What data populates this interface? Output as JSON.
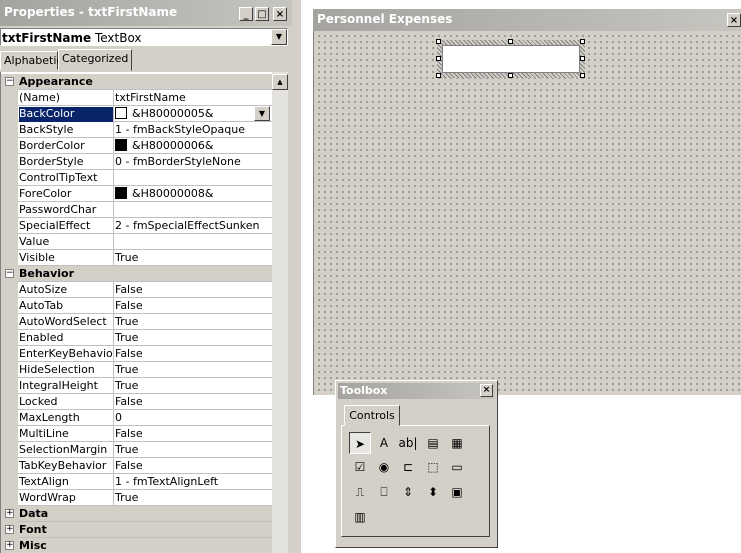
{
  "properties": {
    "title": "Properties - txtFirstName",
    "object_name": "txtFirstName",
    "object_type": "TextBox",
    "tabs": [
      "Alphabetic",
      "Categorized"
    ],
    "active_tab": "Categorized",
    "rows": [
      {
        "kind": "cat",
        "name": "Appearance",
        "expander": "⊟"
      },
      {
        "name": "(Name)",
        "value": "txtFirstName"
      },
      {
        "name": "BackColor",
        "value": "&H80000005&",
        "swatch": "#ffffff",
        "selected": true,
        "dropdown": true
      },
      {
        "name": "BackStyle",
        "value": "1 - fmBackStyleOpaque"
      },
      {
        "name": "BorderColor",
        "value": "&H80000006&",
        "swatch": "#000000"
      },
      {
        "name": "BorderStyle",
        "value": "0 - fmBorderStyleNone"
      },
      {
        "name": "ControlTipText",
        "value": ""
      },
      {
        "name": "ForeColor",
        "value": "&H80000008&",
        "swatch": "#000000"
      },
      {
        "name": "PasswordChar",
        "value": ""
      },
      {
        "name": "SpecialEffect",
        "value": "2 - fmSpecialEffectSunken"
      },
      {
        "name": "Value",
        "value": ""
      },
      {
        "name": "Visible",
        "value": "True"
      },
      {
        "kind": "cat",
        "name": "Behavior",
        "expander": "⊟"
      },
      {
        "name": "AutoSize",
        "value": "False"
      },
      {
        "name": "AutoTab",
        "value": "False"
      },
      {
        "name": "AutoWordSelect",
        "value": "True"
      },
      {
        "name": "Enabled",
        "value": "True"
      },
      {
        "name": "EnterKeyBehavior",
        "value": "False"
      },
      {
        "name": "HideSelection",
        "value": "True"
      },
      {
        "name": "IntegralHeight",
        "value": "True"
      },
      {
        "name": "Locked",
        "value": "False"
      },
      {
        "name": "MaxLength",
        "value": "0"
      },
      {
        "name": "MultiLine",
        "value": "False"
      },
      {
        "name": "SelectionMargin",
        "value": "True"
      },
      {
        "name": "TabKeyBehavior",
        "value": "False"
      },
      {
        "name": "TextAlign",
        "value": "1 - fmTextAlignLeft"
      },
      {
        "name": "WordWrap",
        "value": "True"
      },
      {
        "kind": "cat",
        "name": "Data",
        "expander": "⊞"
      },
      {
        "kind": "cat",
        "name": "Font",
        "expander": "⊞"
      },
      {
        "kind": "cat",
        "name": "Misc",
        "expander": "⊞"
      }
    ]
  },
  "userform": {
    "title": "Personnel Expenses"
  },
  "toolbox": {
    "title": "Toolbox",
    "tab": "Controls",
    "tools": [
      {
        "name": "select-objects-icon",
        "glyph": "➤",
        "pressed": true
      },
      {
        "name": "label-icon",
        "glyph": "A"
      },
      {
        "name": "textbox-icon",
        "glyph": "ab|"
      },
      {
        "name": "combobox-icon",
        "glyph": "▤"
      },
      {
        "name": "listbox-icon",
        "glyph": "▦"
      },
      {
        "name": "checkbox-icon",
        "glyph": "☑"
      },
      {
        "name": "optionbutton-icon",
        "glyph": "◉"
      },
      {
        "name": "togglebutton-icon",
        "glyph": "⊏"
      },
      {
        "name": "frame-icon",
        "glyph": "⬚"
      },
      {
        "name": "commandbutton-icon",
        "glyph": "▭"
      },
      {
        "name": "tabstrip-icon",
        "glyph": "⎍"
      },
      {
        "name": "multipage-icon",
        "glyph": "⎕"
      },
      {
        "name": "scrollbar-icon",
        "glyph": "⇕"
      },
      {
        "name": "spinbutton-icon",
        "glyph": "⬍"
      },
      {
        "name": "image-icon",
        "glyph": "▣"
      },
      {
        "name": "refedit-icon",
        "glyph": "▥"
      }
    ]
  },
  "title_buttons": {
    "minimize": "_",
    "maximize": "□",
    "close": "×"
  }
}
